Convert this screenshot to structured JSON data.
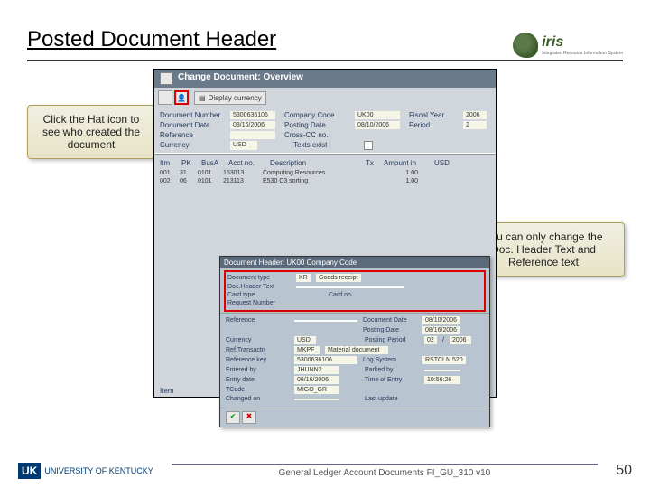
{
  "title": "Posted Document Header",
  "logo": {
    "brand": "iris",
    "sub": "Integrated Resource Information System"
  },
  "callout_left": "Click the Hat icon to see who created the document",
  "callout_right": "You can only change the Doc. Header Text and Reference text",
  "sap": {
    "window_title": "Change Document: Overview",
    "display_currency": "Display currency",
    "form": {
      "doc_number_lbl": "Document Number",
      "doc_number": "5300636106",
      "company_code_lbl": "Company Code",
      "company_code": "UK00",
      "fiscal_year_lbl": "Fiscal Year",
      "fiscal_year": "2006",
      "doc_date_lbl": "Document Date",
      "doc_date": "08/16/2006",
      "posting_date_lbl": "Posting Date",
      "posting_date": "08/10/2006",
      "period_lbl": "Period",
      "period": "2",
      "reference_lbl": "Reference",
      "cross_cc_lbl": "Cross-CC no.",
      "currency_lbl": "Currency",
      "currency": "USD",
      "texts_exist_lbl": "Texts exist"
    },
    "table": {
      "headers": {
        "c1": "Itm",
        "c2": "PK",
        "c3": "BusA",
        "c4": "Acct no.",
        "c5": "Description",
        "c6": "Tx",
        "c7": "Amount in",
        "c8": "USD"
      },
      "rows": [
        {
          "c1": "001",
          "c2": "31",
          "c3": "0101",
          "c4": "153013",
          "c5": "Computing Resources",
          "c7": "1.00"
        },
        {
          "c1": "002",
          "c2": "06",
          "c3": "0101",
          "c4": "213113",
          "c5": "E530 C3 sorting",
          "c7": "1.00"
        }
      ]
    }
  },
  "popup": {
    "title": "Document Header: UK00 Company Code",
    "doc_type_lbl": "Document type",
    "doc_type_code": "KR",
    "doc_type": "Goods receipt",
    "header_text_lbl": "Doc.Header Text",
    "card_type_lbl": "Card type",
    "card_no_lbl": "Card no.",
    "request_num_lbl": "Request Number",
    "reference_lbl": "Reference",
    "doc_date_lbl": "Document Date",
    "doc_date": "08/10/2006",
    "posting_date_lbl": "Posting Date",
    "posting_date": "08/16/2006",
    "posting_period_lbl": "Posting Period",
    "posting_period_m": "02",
    "posting_period_y": "2006",
    "currency_lbl": "Currency",
    "currency": "USD",
    "ref_trans_lbl": "Ref.Transactn",
    "ref_trans": "MKPF",
    "ref_trans_desc": "Material document",
    "ref_key_lbl": "Reference key",
    "ref_key": "5300636106",
    "log_system_lbl": "Log.System",
    "log_system": "RSTCLN 520",
    "entered_by_lbl": "Entered by",
    "entered_by": "JHUNN2",
    "parked_by_lbl": "Parked by",
    "entry_date_lbl": "Entry date",
    "entry_date": "08/16/2006",
    "time_of_entry_lbl": "Time of Entry",
    "time_of_entry": "10:56:26",
    "tcode_lbl": "TCode",
    "tcode": "MIGO_GR",
    "changed_on_lbl": "Changed on",
    "last_update_lbl": "Last update"
  },
  "bottom_item": "Item",
  "footer": {
    "uk": "UNIVERSITY OF KENTUCKY",
    "mid": "General Ledger Account Documents FI_GU_310 v10",
    "page": "50"
  }
}
